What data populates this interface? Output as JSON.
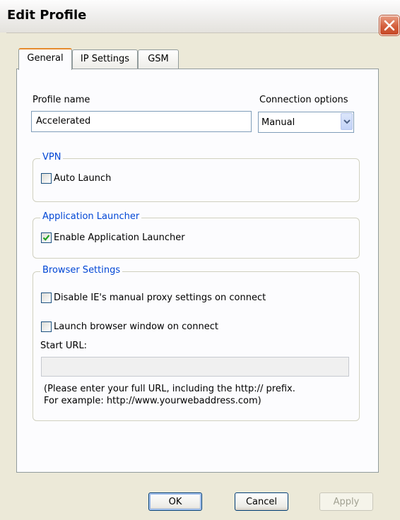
{
  "window": {
    "title": "Edit Profile"
  },
  "tabs": [
    {
      "label": "General",
      "active": true
    },
    {
      "label": "IP Settings",
      "active": false
    },
    {
      "label": "GSM",
      "active": false
    }
  ],
  "general": {
    "profile_name_label": "Profile name",
    "profile_name_value": "Accelerated",
    "connection_options_label": "Connection options",
    "connection_options_value": "Manual",
    "vpn": {
      "legend": "VPN",
      "auto_launch_label": "Auto Launch",
      "auto_launch_checked": false
    },
    "app_launcher": {
      "legend": "Application Launcher",
      "enable_label": "Enable Application Launcher",
      "enable_checked": true
    },
    "browser": {
      "legend": "Browser Settings",
      "disable_proxy_label": "Disable IE's manual proxy settings on connect",
      "disable_proxy_checked": false,
      "launch_browser_label": "Launch browser window on connect",
      "launch_browser_checked": false,
      "start_url_label": "Start URL:",
      "start_url_value": "",
      "hint_line1": "(Please enter your full URL, including the http:// prefix.",
      "hint_line2": "For example: http://www.yourwebaddress.com)"
    }
  },
  "buttons": {
    "ok": "OK",
    "cancel": "Cancel",
    "apply": "Apply"
  },
  "colors": {
    "group_legend": "#0046d5",
    "close_button": "#d45f3d",
    "check_mark": "#21a121"
  }
}
